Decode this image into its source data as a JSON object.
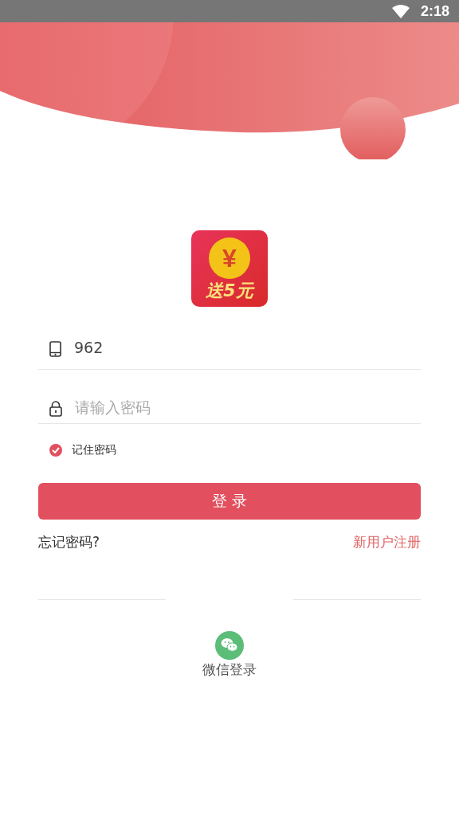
{
  "status_bar": {
    "time": "2:18"
  },
  "logo": {
    "symbol": "¥",
    "text": "送5元"
  },
  "phone_field": {
    "value": "962"
  },
  "password_field": {
    "placeholder": "请输入密码"
  },
  "remember_password": {
    "label": "记住密码",
    "checked": true
  },
  "login_button": {
    "label": "登 录"
  },
  "forgot_password": "忘记密码?",
  "register_link": "新用户注册",
  "wechat_login": {
    "label": "微信登录"
  }
}
